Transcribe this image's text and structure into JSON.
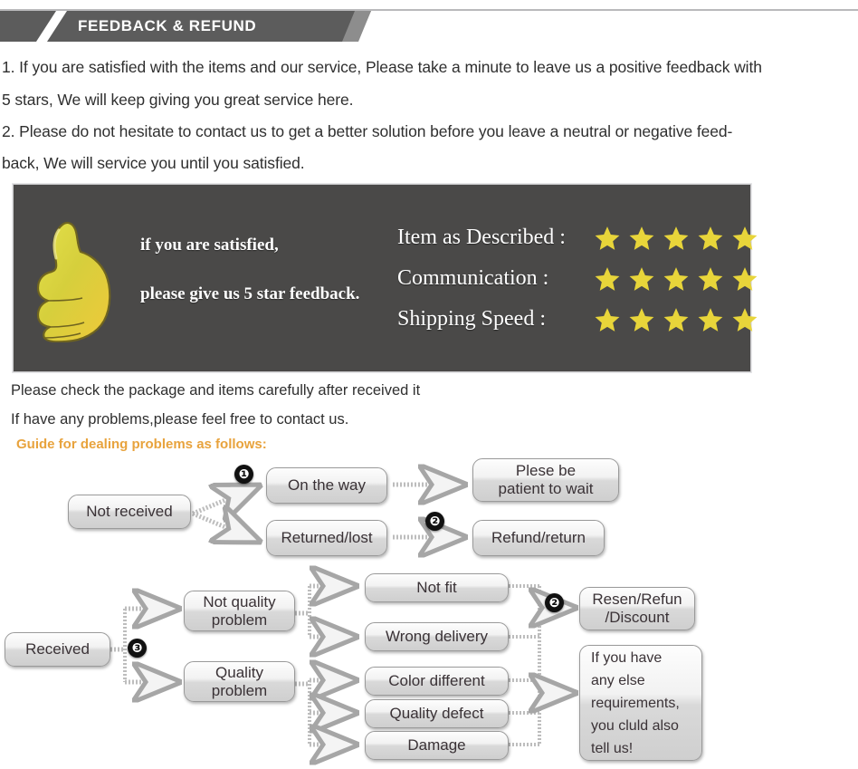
{
  "banner": {
    "title": "FEEDBACK & REFUND"
  },
  "paragraphs": [
    "1. If you are satisfied with the items and our service, Please take a minute to leave us a positive feedback with",
    "5 stars, We will keep giving you great service here.",
    "2. Please do not hesitate to contact us to get a better solution before you leave a neutral or negative feed-",
    "back, We will service you until you satisfied."
  ],
  "feedback_image": {
    "thumb_icon": "thumbs-up-icon",
    "lines": [
      "if you are satisfied,",
      "please give us 5 star feedback."
    ],
    "ratings": [
      {
        "label": "Item as Described :",
        "stars": 5
      },
      {
        "label": "Communication :",
        "stars": 5
      },
      {
        "label": "Shipping Speed :",
        "stars": 5
      }
    ],
    "star_color": "#e8d53a",
    "background": "#4a4948"
  },
  "mid_text": [
    "Please check the package and items carefully after received it",
    "If have any problems,please feel free to contact us."
  ],
  "guide_heading": "Guide for dealing problems as follows:",
  "guide_heading_color": "#e8a33d",
  "flow1": {
    "source": "Not received",
    "marker_1": "❶",
    "marker_2": "❷",
    "branches": [
      {
        "status": "On the way",
        "action": "Plese be\npatient to wait"
      },
      {
        "status": "Returned/lost",
        "action": "Refund/return"
      }
    ]
  },
  "flow2": {
    "source": "Received",
    "marker_3": "❸",
    "marker_2": "❷",
    "categories": [
      {
        "label": "Not quality\nproblem",
        "reasons": [
          "Not fit",
          "Wrong delivery"
        ]
      },
      {
        "label": "Quality\nproblem",
        "reasons": [
          "Color different",
          "Quality defect",
          "Damage"
        ]
      }
    ],
    "outcomes": [
      "Resen/Refun\n/Discount",
      "If you have\nany else\nrequirements,\nyou cluld also\ntell us!"
    ]
  }
}
